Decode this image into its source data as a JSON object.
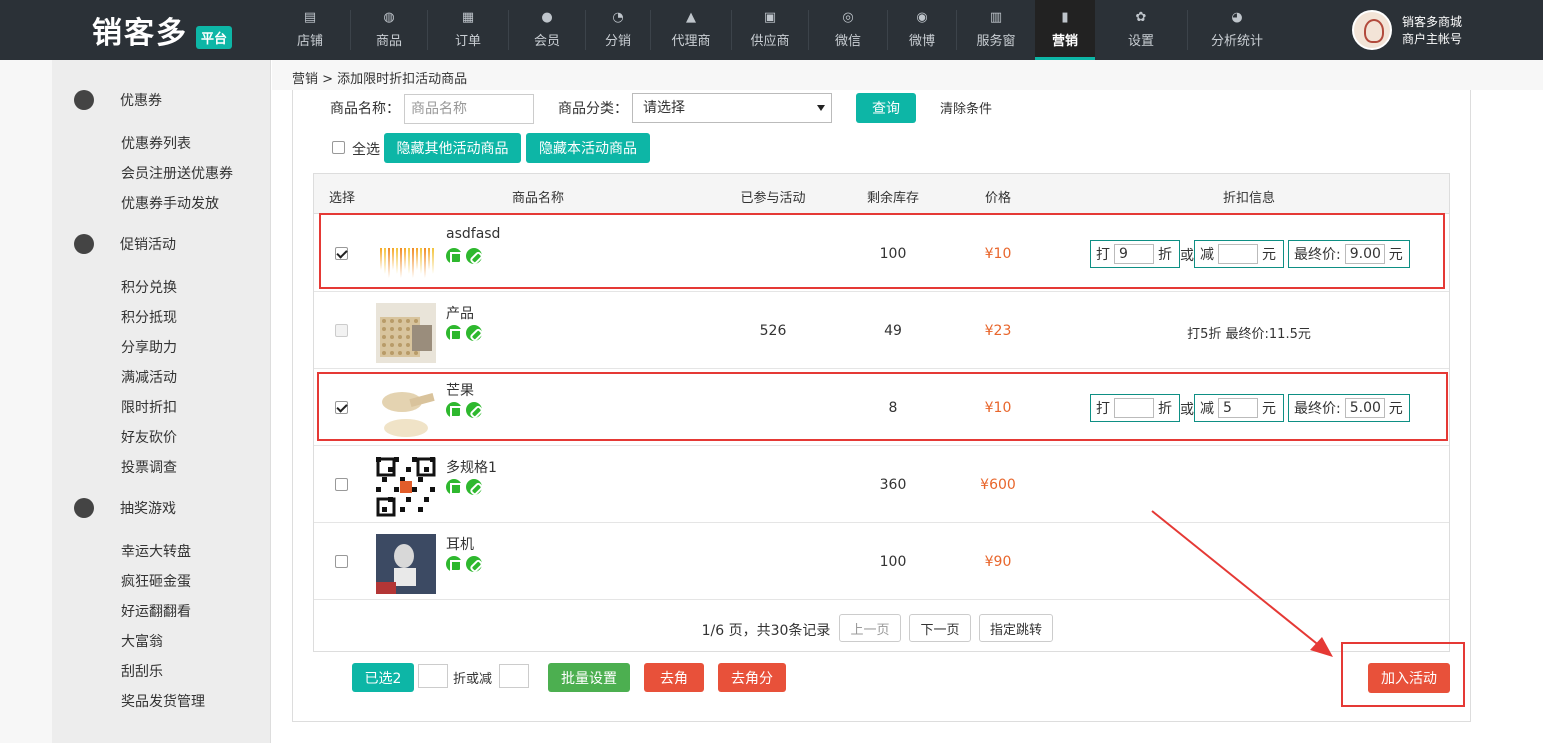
{
  "app": {
    "logo_text": "销客多",
    "logo_badge": "平台"
  },
  "nav": [
    {
      "label": "店铺",
      "icon": "store-icon"
    },
    {
      "label": "商品",
      "icon": "bag-icon"
    },
    {
      "label": "订单",
      "icon": "clipboard-icon"
    },
    {
      "label": "会员",
      "icon": "user-icon"
    },
    {
      "label": "分销",
      "icon": "pie-icon"
    },
    {
      "label": "代理商",
      "icon": "agent-icon"
    },
    {
      "label": "供应商",
      "icon": "supplier-icon"
    },
    {
      "label": "微信",
      "icon": "wechat-icon"
    },
    {
      "label": "微博",
      "icon": "weibo-icon"
    },
    {
      "label": "服务窗",
      "icon": "service-icon"
    },
    {
      "label": "营销",
      "icon": "chart-icon",
      "active": true
    },
    {
      "label": "设置",
      "icon": "gear-icon"
    },
    {
      "label": "分析统计",
      "icon": "analytics-icon"
    }
  ],
  "account": {
    "name": "销客多商城",
    "role": "商户主帐号"
  },
  "sidebar": {
    "groups": [
      {
        "title": "优惠券",
        "icon": "coupon-icon",
        "items": [
          "优惠券列表",
          "会员注册送优惠券",
          "优惠券手动发放"
        ]
      },
      {
        "title": "促销活动",
        "icon": "promo-icon",
        "items": [
          "积分兑换",
          "积分抵现",
          "分享助力",
          "满减活动",
          "限时折扣",
          "好友砍价",
          "投票调查"
        ]
      },
      {
        "title": "抽奖游戏",
        "icon": "lottery-icon",
        "items": [
          "幸运大转盘",
          "疯狂砸金蛋",
          "好运翻翻看",
          "大富翁",
          "刮刮乐",
          "奖品发货管理"
        ]
      }
    ]
  },
  "breadcrumb": "营销 > 添加限时折扣活动商品",
  "filters": {
    "name_label": "商品名称：",
    "name_placeholder": "商品名称",
    "category_label": "商品分类：",
    "category_value": "请选择",
    "query_button": "查询",
    "clear_button": "清除条件",
    "select_all": "全选",
    "hide_other": "隐藏其他活动商品",
    "hide_this": "隐藏本活动商品"
  },
  "table": {
    "columns": [
      "选择",
      "商品名称",
      "已参与活动",
      "剩余库存",
      "价格",
      "折扣信息"
    ],
    "rows": [
      {
        "name": "asdfasd",
        "checked": true,
        "disabled": false,
        "activity": "",
        "stock": "100",
        "price": "¥10",
        "mode": "edit",
        "discount": "9",
        "reduce": "",
        "final": "9.00"
      },
      {
        "name": "产品",
        "checked": false,
        "disabled": true,
        "activity": "526",
        "stock": "49",
        "price": "¥23",
        "mode": "text",
        "info": "打5折  最终价:11.5元"
      },
      {
        "name": "芒果",
        "checked": true,
        "disabled": false,
        "activity": "",
        "stock": "8",
        "price": "¥10",
        "mode": "edit",
        "discount": "",
        "reduce": "5",
        "final": "5.00"
      },
      {
        "name": "多规格1",
        "checked": false,
        "disabled": false,
        "activity": "",
        "stock": "360",
        "price": "¥600",
        "mode": "none"
      },
      {
        "name": "耳机",
        "checked": false,
        "disabled": false,
        "activity": "",
        "stock": "100",
        "price": "¥90",
        "mode": "none"
      }
    ],
    "labels": {
      "da": "打",
      "zhe": "折",
      "or": "或",
      "jian": "减",
      "yuan": "元",
      "final": "最终价:"
    }
  },
  "pagination": {
    "info": "1/6 页，共30条记录",
    "prev": "上一页",
    "next": "下一页",
    "jump": "指定跳转"
  },
  "bottom": {
    "selected": "已选2",
    "discount_or_reduce": "折或减",
    "batch": "批量设置",
    "round_jiao": "去角",
    "round_jiaofen": "去角分",
    "join": "加入活动"
  },
  "colors": {
    "teal": "#0db6a6",
    "nav_bg": "#2b3137",
    "price": "#e8662c",
    "danger": "#e8513a",
    "green": "#4caf50",
    "highlight": "#e53935"
  }
}
